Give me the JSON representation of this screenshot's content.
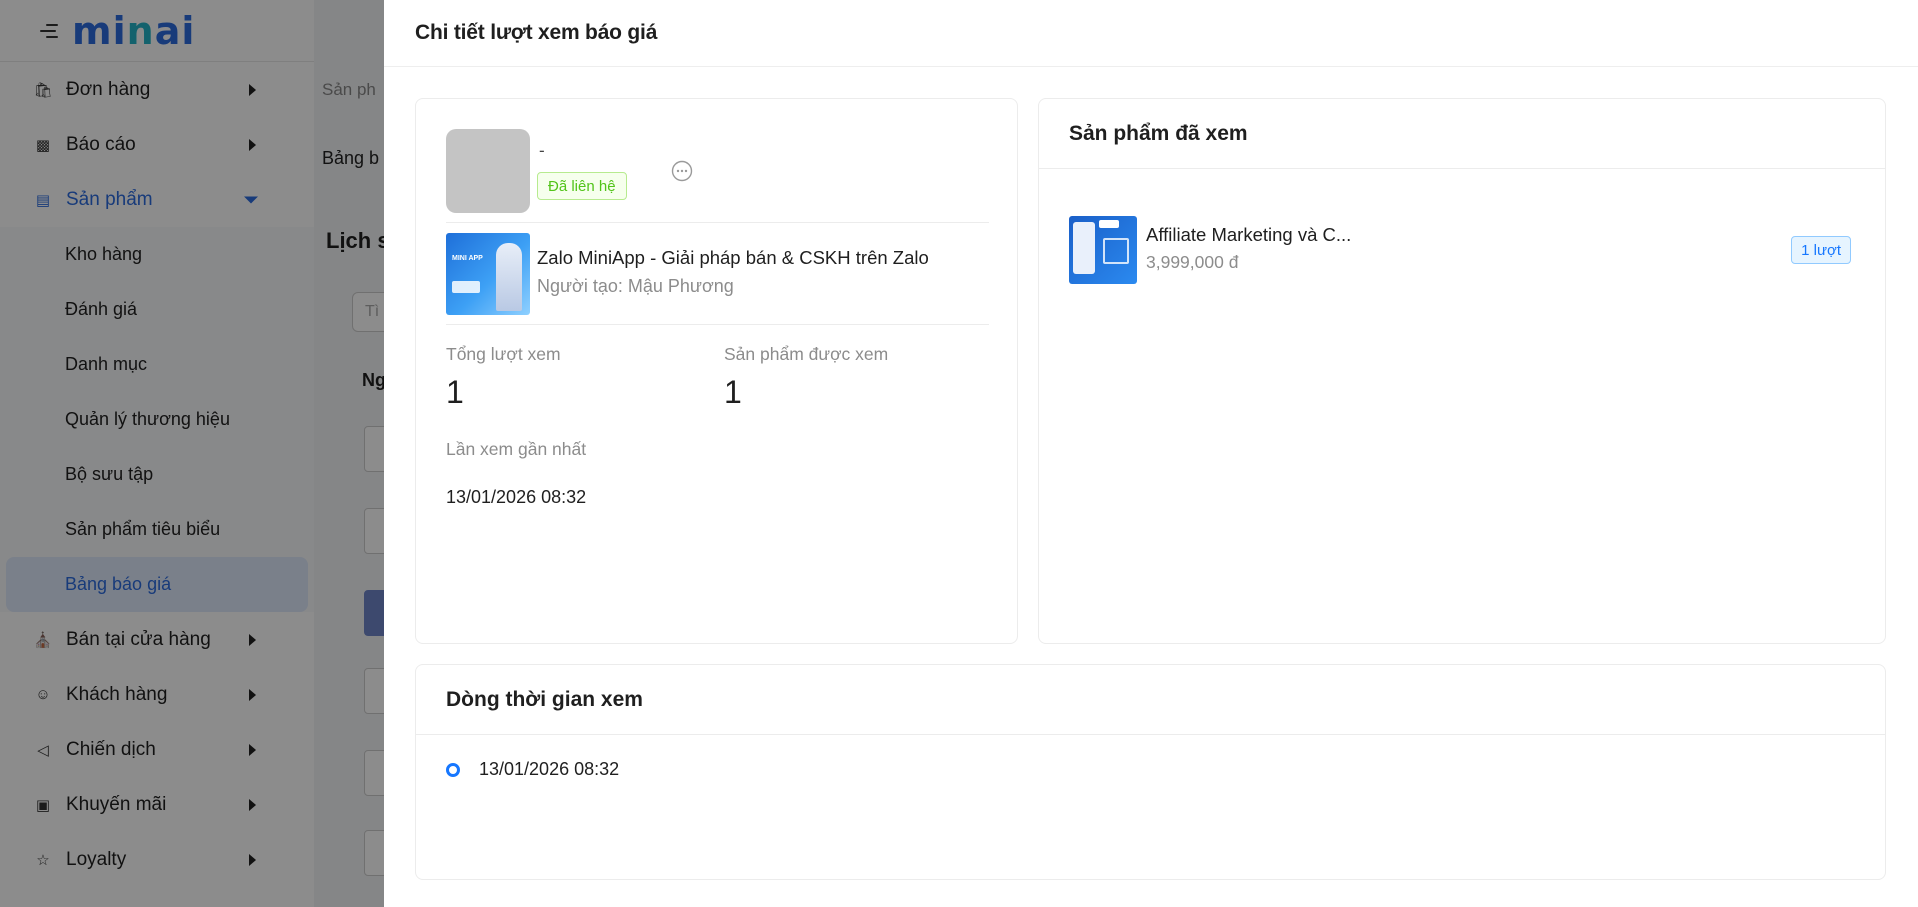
{
  "sidebar": {
    "logo": {
      "part1": "mi",
      "part2": "n",
      "part3": "ai"
    },
    "items": [
      {
        "label": "Đơn hàng",
        "icon": "shopping-bag-icon"
      },
      {
        "label": "Báo cáo",
        "icon": "bar-chart-icon"
      },
      {
        "label": "Sản phẩm",
        "icon": "product-icon"
      },
      {
        "label": "Bán tại cửa hàng",
        "icon": "store-icon"
      },
      {
        "label": "Khách hàng",
        "icon": "customers-icon"
      },
      {
        "label": "Chiến dịch",
        "icon": "megaphone-icon"
      },
      {
        "label": "Khuyến mãi",
        "icon": "gift-icon"
      },
      {
        "label": "Loyalty",
        "icon": "star-icon"
      }
    ],
    "sub_items": [
      {
        "label": "Kho hàng"
      },
      {
        "label": "Đánh giá"
      },
      {
        "label": "Danh mục"
      },
      {
        "label": "Quản lý thương hiệu"
      },
      {
        "label": "Bộ sưu tập"
      },
      {
        "label": "Sản phẩm tiêu biểu"
      },
      {
        "label": "Bảng báo giá"
      }
    ]
  },
  "background": {
    "breadcrumb": "Sản ph",
    "page_title": "Bảng b",
    "section_title": "Lịch s",
    "search_placeholder": "Tì",
    "column_header": "Ng"
  },
  "drawer": {
    "title": "Chi tiết lượt xem báo giá",
    "customer": {
      "name": "-",
      "status_tag": "Đã liên hệ"
    },
    "quote": {
      "name": "Zalo MiniApp - Giải pháp bán & CSKH trên Zalo",
      "creator": "Người tạo: Mậu Phương"
    },
    "stats": {
      "total_views_label": "Tổng lượt xem",
      "total_views_value": "1",
      "products_viewed_label": "Sản phẩm được xem",
      "products_viewed_value": "1",
      "last_view_label": "Lần xem gần nhất",
      "last_view_value": "13/01/2026 08:32"
    },
    "viewed_products": {
      "title": "Sản phẩm đã xem",
      "items": [
        {
          "name": "Affiliate Marketing và C...",
          "price": "3,999,000 đ",
          "views_tag": "1 lượt"
        }
      ]
    },
    "timeline": {
      "title": "Dòng thời gian xem",
      "items": [
        {
          "time": "13/01/2026 08:32"
        }
      ]
    }
  },
  "colors": {
    "accent": "#2d6cdf",
    "success": "#52c41a",
    "info": "#1677ff"
  }
}
